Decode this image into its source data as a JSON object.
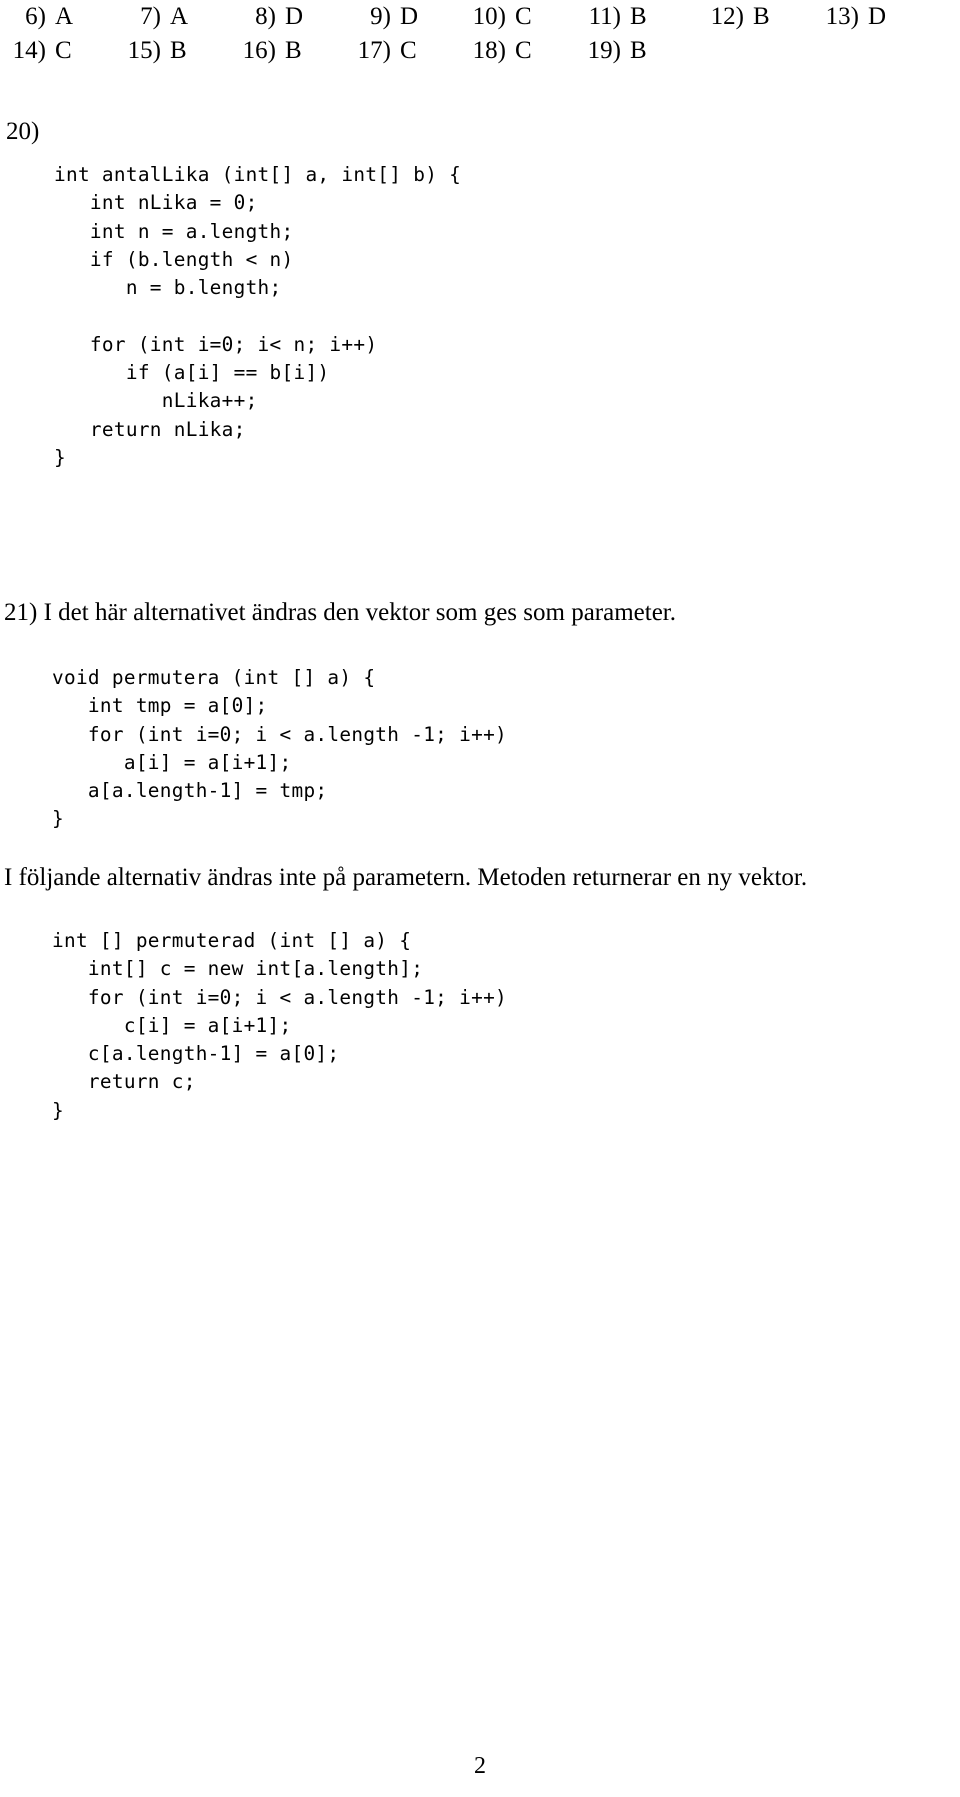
{
  "document": {
    "page_number": "2"
  },
  "answer_key": {
    "rows": [
      [
        {
          "number": "6)",
          "answer": "A"
        },
        {
          "number": "7)",
          "answer": "A"
        },
        {
          "number": "8)",
          "answer": "D"
        },
        {
          "number": "9)",
          "answer": "D"
        },
        {
          "number": "10)",
          "answer": "C"
        },
        {
          "number": "11)",
          "answer": "B"
        },
        {
          "number": "12)",
          "answer": "B"
        },
        {
          "number": "13)",
          "answer": "D"
        }
      ],
      [
        {
          "number": "14)",
          "answer": "C"
        },
        {
          "number": "15)",
          "answer": "B"
        },
        {
          "number": "16)",
          "answer": "B"
        },
        {
          "number": "17)",
          "answer": "C"
        },
        {
          "number": "18)",
          "answer": "C"
        },
        {
          "number": "19)",
          "answer": "B"
        }
      ]
    ]
  },
  "question20": {
    "label": "20)",
    "code": "int antalLika (int[] a, int[] b) {\n   int nLika = 0;\n   int n = a.length;\n   if (b.length < n)\n      n = b.length;\n\n   for (int i=0; i< n; i++)\n      if (a[i] == b[i])\n         nLika++;\n   return nLika;\n}"
  },
  "question21": {
    "intro": "21) I det här alternativet ändras den vektor som ges som parameter.",
    "code_permutera": "void permutera (int [] a) {\n   int tmp = a[0];\n   for (int i=0; i < a.length -1; i++)\n      a[i] = a[i+1];\n   a[a.length-1] = tmp;\n}",
    "note": "I följande alternativ ändras inte på parametern. Metoden returnerar en ny vektor.",
    "code_permuterad": "int [] permuterad (int [] a) {\n   int[] c = new int[a.length];\n   for (int i=0; i < a.length -1; i++)\n      c[i] = a[i+1];\n   c[a.length-1] = a[0];\n   return c;\n}"
  }
}
